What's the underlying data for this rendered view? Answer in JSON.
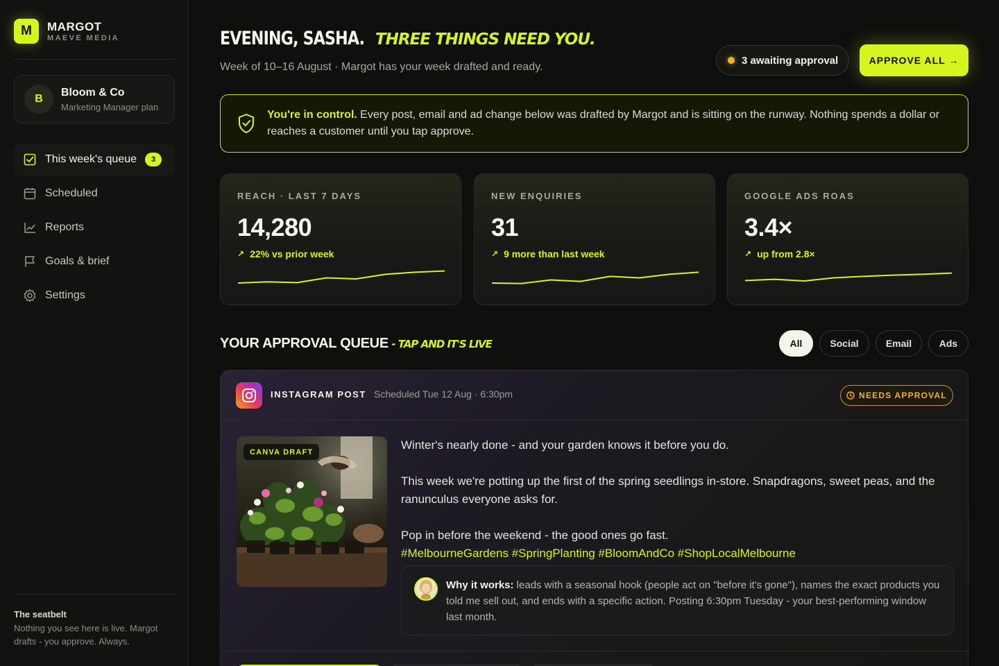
{
  "brand": {
    "logo_letter": "M",
    "name": "MARGOT",
    "sub": "MAEVE MEDIA",
    "accent": "#d6f51f"
  },
  "account": {
    "initial": "B",
    "name": "Bloom & Co",
    "plan": "Marketing Manager plan"
  },
  "nav": {
    "items": [
      {
        "label": "This week's queue",
        "icon": "checkbox-icon",
        "badge": "3",
        "active": true
      },
      {
        "label": "Scheduled",
        "icon": "calendar-icon"
      },
      {
        "label": "Reports",
        "icon": "chart-icon"
      },
      {
        "label": "Goals & brief",
        "icon": "flag-icon"
      },
      {
        "label": "Settings",
        "icon": "gear-icon"
      }
    ]
  },
  "seatbelt": {
    "title": "The seatbelt",
    "text": "Nothing you see here is live. Margot drafts - you approve. Always."
  },
  "header": {
    "greeting": "EVENING, SASHA.",
    "greeting_accent": "THREE THINGS NEED YOU.",
    "week_line": "Week of 10–16 August · Margot has your week drafted and ready.",
    "awaiting": "3 awaiting approval",
    "approve_all": "APPROVE ALL →"
  },
  "banner": {
    "strong": "You're in control.",
    "text": " Every post, email and ad change below was drafted by Margot and is sitting on the runway. Nothing spends a dollar or reaches a customer until you tap approve."
  },
  "stats": [
    {
      "label": "REACH · LAST 7 DAYS",
      "value": "14,280",
      "delta": "22% vs prior week",
      "trend": [
        0.3,
        0.36,
        0.32,
        0.55,
        0.5,
        0.72,
        0.82,
        0.88
      ]
    },
    {
      "label": "NEW ENQUIRIES",
      "value": "31",
      "delta": "9 more than last week",
      "trend": [
        0.3,
        0.28,
        0.45,
        0.38,
        0.62,
        0.55,
        0.72,
        0.82
      ]
    },
    {
      "label": "GOOGLE ADS ROAS",
      "value": "3.4×",
      "delta": "up from 2.8×",
      "trend": [
        0.42,
        0.48,
        0.4,
        0.55,
        0.62,
        0.68,
        0.72,
        0.78
      ]
    }
  ],
  "queue": {
    "title": "YOUR APPROVAL QUEUE",
    "title_accent": "- TAP AND IT'S LIVE",
    "filters": [
      "All",
      "Social",
      "Email",
      "Ads"
    ],
    "active_filter": "All"
  },
  "post": {
    "type": "INSTAGRAM POST",
    "scheduled": "Scheduled Tue 12 Aug · 6:30pm",
    "status": "NEEDS APPROVAL",
    "image_chip": "CANVA DRAFT",
    "caption": [
      "Winter's nearly done - and your garden knows it before you do.",
      "This week we're potting up the first of the spring seedlings in-store. Snapdragons, sweet peas, and the ranunculus everyone asks for.",
      "Pop in before the weekend - the good ones go fast."
    ],
    "hashtags": "#MelbourneGardens #SpringPlanting #BloomAndCo #ShopLocalMelbourne",
    "why_label": "Why it works:",
    "why_text": " leads with a seasonal hook (people act on \"before it's gone\"), names the exact products you told me sell out, and ends with a specific action. Posting 6:30pm Tuesday - your best-performing window last month."
  }
}
